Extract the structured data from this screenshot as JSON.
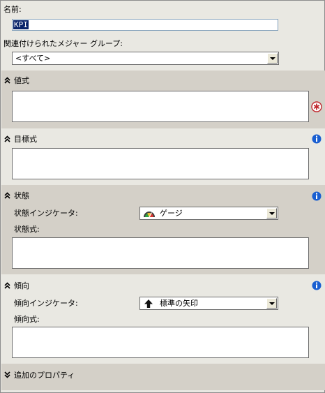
{
  "name": {
    "label": "名前:",
    "value": "KPI"
  },
  "measure_group": {
    "label": "関連付けられたメジャー グループ:",
    "selected": "<すべて>"
  },
  "value_section": {
    "title": "値式"
  },
  "goal_section": {
    "title": "目標式"
  },
  "status_section": {
    "title": "状態",
    "indicator_label": "状態インジケータ:",
    "indicator_selected": "ゲージ",
    "expression_label": "状態式:"
  },
  "trend_section": {
    "title": "傾向",
    "indicator_label": "傾向インジケータ:",
    "indicator_selected": "標準の矢印",
    "expression_label": "傾向式:"
  },
  "additional_section": {
    "title": "追加のプロパティ"
  },
  "icons": {
    "collapse": "double-chevron-up-icon",
    "expand": "double-chevron-down-icon",
    "info": "info-icon",
    "required": "required-asterisk-icon",
    "gauge": "gauge-icon",
    "arrow": "up-arrow-icon"
  },
  "colors": {
    "info_blue": "#1a5fd1",
    "error_red": "#c0282e",
    "selection": "#0a246a"
  }
}
